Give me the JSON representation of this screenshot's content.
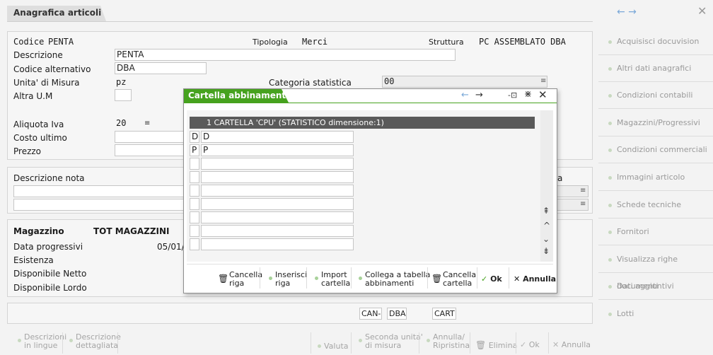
{
  "window": {
    "title": "Anagrafica articoli",
    "nav_arrows": "← →",
    "close_glyph": "✕"
  },
  "header": {
    "codice_label": "Codice",
    "codice_value": "PENTA",
    "tipologia_label": "Tipologia",
    "tipologia_value": "Merci",
    "struttura_label": "Struttura",
    "struttura_value": "PC ASSEMBLATO DBA"
  },
  "form": {
    "descrizione_label": "Descrizione",
    "descrizione_value": "PENTA",
    "codice_alt_label": "Codice alternativo",
    "codice_alt_value": "DBA",
    "um_label": "Unita' di Misura",
    "um_value": "pz",
    "categoria_label": "Categoria statistica",
    "categoria_value": "00",
    "altra_um_label": "Altra U.M",
    "aliquota_label": "Aliquota Iva",
    "aliquota_value": "20",
    "costo_label": "Costo ultimo",
    "prezzo_label": "Prezzo"
  },
  "nota": {
    "label": "Descrizione nota",
    "right_label_fragment": "a"
  },
  "magazzino": {
    "title": "Magazzino",
    "value": "TOT MAGAZZINI",
    "data_prog_label": "Data progressivi",
    "data_prog_value": "05/01/:",
    "esistenza_label": "Esistenza",
    "disp_netto_label": "Disponibile Netto",
    "disp_lordo_label": "Disponibile Lordo"
  },
  "codes_bar": {
    "c1": "CAN-",
    "c2": "DBA",
    "c3": "CART"
  },
  "sidebar": {
    "items": [
      {
        "label": "Acquisisci docuvision"
      },
      {
        "label": "Altri dati anagrafici"
      },
      {
        "label": "Condizioni contabili"
      },
      {
        "label": "Magazzini/Progressivi"
      },
      {
        "label": "Condizioni commerciali"
      },
      {
        "label": "Immagini articolo"
      },
      {
        "label": "Schede tecniche"
      },
      {
        "label": "Fornitori"
      },
      {
        "label": "Visualizza righe documenti"
      },
      {
        "label": "Dati aggiuntivi"
      },
      {
        "label": "Lotti"
      }
    ]
  },
  "bottom_bar": {
    "descr_lingue_1": "Descrizioni",
    "descr_lingue_2": "in lingue",
    "descr_dett_1": "Descrizione",
    "descr_dett_2": "dettagliata",
    "valuta": "Valuta",
    "seconda_1": "Seconda unita'",
    "seconda_2": "di misura",
    "annulla_rip_1": "Annulla/",
    "annulla_rip_2": "Ripristina",
    "elimina": "Elimina",
    "ok": "Ok",
    "annulla": "Annulla"
  },
  "popup": {
    "title": "Cartella abbinamenti",
    "header_row": "1  CARTELLA 'CPU' (STATISTICO dimensione:1)",
    "rows": [
      {
        "code": "D",
        "value": "D"
      },
      {
        "code": "P",
        "value": "P"
      },
      {
        "code": "",
        "value": ""
      },
      {
        "code": "",
        "value": ""
      },
      {
        "code": "",
        "value": ""
      },
      {
        "code": "",
        "value": ""
      },
      {
        "code": "",
        "value": ""
      },
      {
        "code": "",
        "value": ""
      },
      {
        "code": "",
        "value": ""
      }
    ],
    "buttons": {
      "cancella_riga_1": "Cancella",
      "cancella_riga_2": "riga",
      "inserisci_1": "Inserisci",
      "inserisci_2": "riga",
      "import_1": "Import",
      "import_2": "cartella",
      "collega_1": "Collega a tabella",
      "collega_2": "abbinamenti",
      "cancella_cart_1": "Cancella",
      "cancella_cart_2": "cartella",
      "ok": "Ok",
      "annulla": "Annulla"
    }
  },
  "colors": {
    "accent_green": "#46a21e",
    "popup_header": "#5a5a5a"
  }
}
